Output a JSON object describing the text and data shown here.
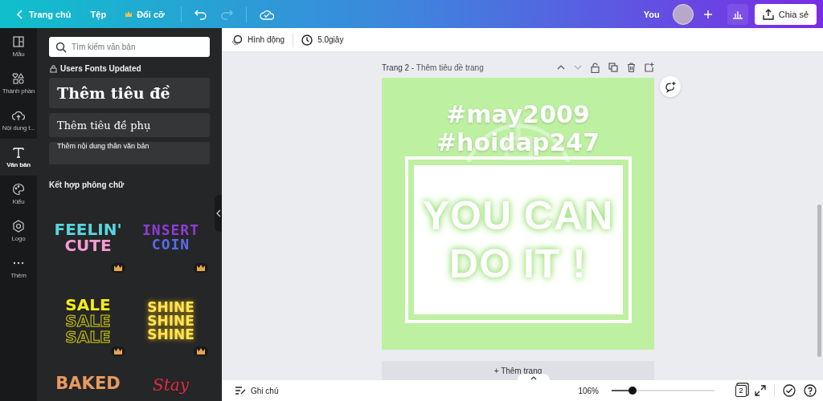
{
  "topbar": {
    "back": "Trang chủ",
    "menu": [
      {
        "label": "Tệp",
        "premium": false
      },
      {
        "label": "Đổi cỡ",
        "premium": true
      }
    ],
    "user": "You",
    "share": "Chia sẻ"
  },
  "rail": [
    {
      "label": "Mẫu",
      "selected": false
    },
    {
      "label": "Thành phần",
      "selected": false
    },
    {
      "label": "Nội dung t...",
      "selected": false
    },
    {
      "label": "Văn bản",
      "selected": true
    },
    {
      "label": "Kiểu",
      "selected": false
    },
    {
      "label": "Logo",
      "selected": false
    },
    {
      "label": "Thêm",
      "selected": false
    }
  ],
  "panel": {
    "search": {
      "placeholder": "Tìm kiếm văn bản"
    },
    "brand_heading": "Users Fonts Updated",
    "text_buttons": [
      {
        "label": "Thêm tiêu đề",
        "kind": "heading"
      },
      {
        "label": "Thêm tiêu đề phụ",
        "kind": "subheading"
      },
      {
        "label": "Thêm nội dung thân văn bản",
        "kind": "body"
      }
    ],
    "combos_heading": "Kết hợp phông chữ",
    "combos": [
      {
        "lines": [
          "FEELIN'",
          "CUTE"
        ],
        "kind": "feelin",
        "premium": true
      },
      {
        "lines": [
          "INSERT",
          "COIN"
        ],
        "kind": "pixel",
        "premium": true
      },
      {
        "lines": [
          "SALE",
          "SALE",
          "SALE"
        ],
        "kind": "sale",
        "premium": true
      },
      {
        "lines": [
          "SHINE",
          "SHINE",
          "SHINE"
        ],
        "kind": "shine",
        "premium": true
      },
      {
        "lines": [
          "BAKED"
        ],
        "kind": "baked",
        "premium": false
      },
      {
        "lines": [
          "Stay"
        ],
        "kind": "script",
        "premium": false
      }
    ]
  },
  "toolbar": {
    "animate": "Hình động",
    "duration": "5.0giây"
  },
  "page": {
    "number": "Trang 2 -",
    "title_placeholder": "Thêm tiêu đề trang",
    "hashtags": [
      "#may2009",
      "#hoidap247"
    ],
    "headline": [
      "YOU CAN",
      "DO IT !"
    ],
    "add_page": "+ Thêm trang"
  },
  "bottombar": {
    "notes": "Ghi chú",
    "zoom": "106%",
    "zoom_slider": {
      "level": 0.2
    },
    "pages": "2"
  }
}
